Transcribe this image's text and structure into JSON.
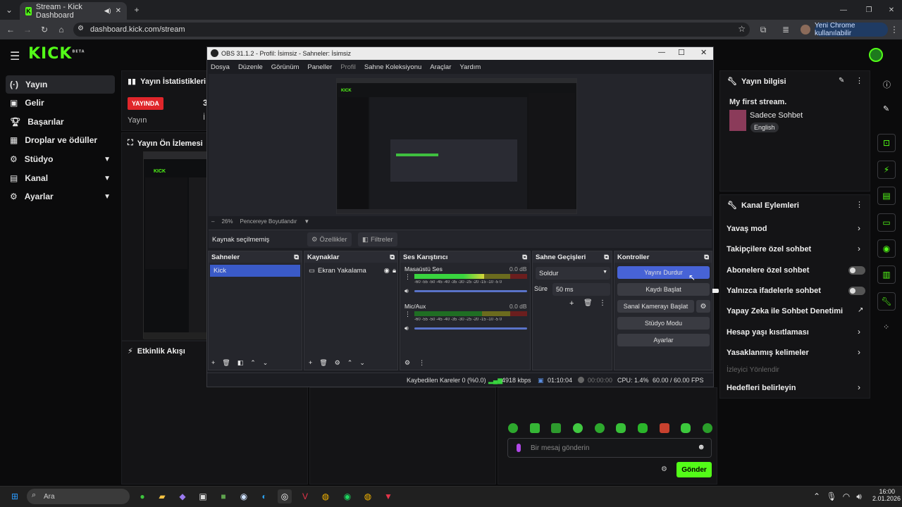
{
  "browser": {
    "tab_title": "Stream - Kick Dashboard",
    "url": "dashboard.kick.com/stream",
    "profile_label": "Yeni Chrome kullanılabilir"
  },
  "kick": {
    "logo": "KICK",
    "logo_sup": "BETA",
    "sidebar": [
      {
        "label": "Yayın",
        "icon": "broadcast-icon",
        "active": true,
        "chevron": false
      },
      {
        "label": "Gelir",
        "icon": "money-icon",
        "active": false,
        "chevron": false
      },
      {
        "label": "Başarılar",
        "icon": "trophy-icon",
        "active": false,
        "chevron": false
      },
      {
        "label": "Droplar ve ödüller",
        "icon": "gift-icon",
        "active": false,
        "chevron": false
      },
      {
        "label": "Stüdyo",
        "icon": "studio-icon",
        "active": false,
        "chevron": true
      },
      {
        "label": "Kanal",
        "icon": "channel-icon",
        "active": false,
        "chevron": true
      },
      {
        "label": "Ayarlar",
        "icon": "gear-icon",
        "active": false,
        "chevron": true
      }
    ],
    "stats": {
      "title": "Yayın İstatistikleri",
      "badge": "YAYINDA",
      "sub": "Yayın",
      "num": "3",
      "sub2": "İ"
    },
    "preview_title": "Yayın Ön İzlemesi",
    "activity_title": "Etkinlik Akışı",
    "stream_info": {
      "title": "Yayın bilgisi",
      "stream_title": "My first stream.",
      "category": "Sadece Sohbet",
      "language": "English"
    },
    "channel_actions": {
      "title": "Kanal Eylemleri",
      "items": [
        {
          "label": "Yavaş mod",
          "control": "chevron"
        },
        {
          "label": "Takipçilere özel sohbet",
          "control": "chevron"
        },
        {
          "label": "Abonelere özel sohbet",
          "control": "toggle"
        },
        {
          "label": "Yalnızca ifadelerle sohbet",
          "control": "toggle"
        },
        {
          "label": "Yapay Zeka ile Sohbet Denetimi",
          "control": "external"
        },
        {
          "label": "Hesap yaşı kısıtlaması",
          "control": "chevron"
        },
        {
          "label": "Yasaklanmış kelimeler",
          "control": "chevron"
        },
        {
          "label": "İzleyici Yönlendir",
          "control": "none"
        },
        {
          "label": "Hedefleri belirleyin",
          "control": "chevron"
        }
      ]
    },
    "chat": {
      "placeholder": "Bir mesaj gönderin",
      "send": "Gönder"
    }
  },
  "obs": {
    "title": "OBS 31.1.2 - Profil: İsimsiz - Sahneler: İsimsiz",
    "menu": [
      "Dosya",
      "Düzenle",
      "Görünüm",
      "Paneller",
      "Profil",
      "Sahne Koleksiyonu",
      "Araçlar",
      "Yardım"
    ],
    "zoom": "26%",
    "fit": "Pencereye Boyutlandır",
    "no_source": "Kaynak seçilmemiş",
    "properties": "Özellikler",
    "filters": "Filtreler",
    "scenes_title": "Sahneler",
    "scene": "Kick",
    "sources_title": "Kaynaklar",
    "source": "Ekran Yakalama",
    "mixer_title": "Ses Karıştırıcı",
    "mixer": [
      {
        "name": "Masaüstü Ses",
        "db": "0.0 dB",
        "level": 0.62
      },
      {
        "name": "Mic/Aux",
        "db": "0.0 dB",
        "level": 0.0
      }
    ],
    "scale": "-60 -55 -50 -45 -40 -35 -30 -25 -20 -15 -10 -5 0",
    "transitions_title": "Sahne Geçişleri",
    "transition": "Soldur",
    "duration_label": "Süre",
    "duration": "50 ms",
    "controls_title": "Kontroller",
    "controls": [
      "Yayını Durdur",
      "Kaydı Başlat",
      "Sanal Kamerayı Başlat",
      "Stüdyo Modu",
      "Ayarlar"
    ],
    "status": {
      "dropped": "Kaybedilen Kareler 0 (%0.0)",
      "kbps": "4918 kbps",
      "time": "01:10:04",
      "rec": "00:00:00",
      "cpu": "CPU: 1.4%",
      "fps": "60.00 / 60.00 FPS"
    }
  },
  "taskbar": {
    "search": "Ara",
    "time": "16:00",
    "date": "2.01.2026"
  }
}
